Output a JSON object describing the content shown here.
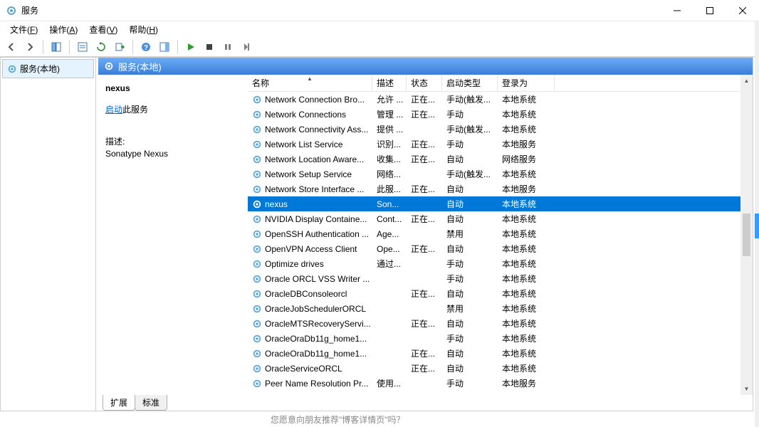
{
  "window": {
    "title": "服务"
  },
  "menus": {
    "file": "文件(F)",
    "action": "操作(A)",
    "view": "查看(V)",
    "help": "帮助(H)"
  },
  "nav": {
    "root": "服务(本地)"
  },
  "content_header": "服务(本地)",
  "detail": {
    "selected_name": "nexus",
    "start_link": "启动",
    "start_suffix": "此服务",
    "desc_label": "描述:",
    "desc_text": "Sonatype Nexus"
  },
  "columns": {
    "name": "名称",
    "desc": "描述",
    "status": "状态",
    "startup": "启动类型",
    "logon": "登录为"
  },
  "tabs": {
    "extended": "扩展",
    "standard": "标准"
  },
  "bottom_fragment": "您愿意向朋友推荐\"博客详情页\"吗？",
  "services": [
    {
      "name": "Network Connection Bro...",
      "desc": "允许 ...",
      "status": "正在...",
      "startup": "手动(触发...",
      "logon": "本地系统"
    },
    {
      "name": "Network Connections",
      "desc": "管理 ...",
      "status": "正在...",
      "startup": "手动",
      "logon": "本地系统"
    },
    {
      "name": "Network Connectivity Ass...",
      "desc": "提供 ...",
      "status": "",
      "startup": "手动(触发...",
      "logon": "本地系统"
    },
    {
      "name": "Network List Service",
      "desc": "识别...",
      "status": "正在...",
      "startup": "手动",
      "logon": "本地服务"
    },
    {
      "name": "Network Location Aware...",
      "desc": "收集...",
      "status": "正在...",
      "startup": "自动",
      "logon": "网络服务"
    },
    {
      "name": "Network Setup Service",
      "desc": "网络...",
      "status": "",
      "startup": "手动(触发...",
      "logon": "本地系统"
    },
    {
      "name": "Network Store Interface ...",
      "desc": "此服...",
      "status": "正在...",
      "startup": "自动",
      "logon": "本地服务"
    },
    {
      "name": "nexus",
      "desc": "Son...",
      "status": "",
      "startup": "自动",
      "logon": "本地系统",
      "selected": true
    },
    {
      "name": "NVIDIA Display Containe...",
      "desc": "Cont...",
      "status": "正在...",
      "startup": "自动",
      "logon": "本地系统"
    },
    {
      "name": "OpenSSH Authentication ...",
      "desc": "Age...",
      "status": "",
      "startup": "禁用",
      "logon": "本地系统"
    },
    {
      "name": "OpenVPN Access Client",
      "desc": "Ope...",
      "status": "正在...",
      "startup": "自动",
      "logon": "本地系统"
    },
    {
      "name": "Optimize drives",
      "desc": "通过...",
      "status": "",
      "startup": "手动",
      "logon": "本地系统"
    },
    {
      "name": "Oracle ORCL VSS Writer ...",
      "desc": "",
      "status": "",
      "startup": "手动",
      "logon": "本地系统"
    },
    {
      "name": "OracleDBConsoleorcl",
      "desc": "",
      "status": "正在...",
      "startup": "自动",
      "logon": "本地系统"
    },
    {
      "name": "OracleJobSchedulerORCL",
      "desc": "",
      "status": "",
      "startup": "禁用",
      "logon": "本地系统"
    },
    {
      "name": "OracleMTSRecoveryServi...",
      "desc": "",
      "status": "正在...",
      "startup": "自动",
      "logon": "本地系统"
    },
    {
      "name": "OracleOraDb11g_home1...",
      "desc": "",
      "status": "",
      "startup": "手动",
      "logon": "本地系统"
    },
    {
      "name": "OracleOraDb11g_home1...",
      "desc": "",
      "status": "正在...",
      "startup": "自动",
      "logon": "本地系统"
    },
    {
      "name": "OracleServiceORCL",
      "desc": "",
      "status": "正在...",
      "startup": "自动",
      "logon": "本地系统"
    },
    {
      "name": "Peer Name Resolution Pr...",
      "desc": "使用...",
      "status": "",
      "startup": "手动",
      "logon": "本地服务"
    }
  ]
}
